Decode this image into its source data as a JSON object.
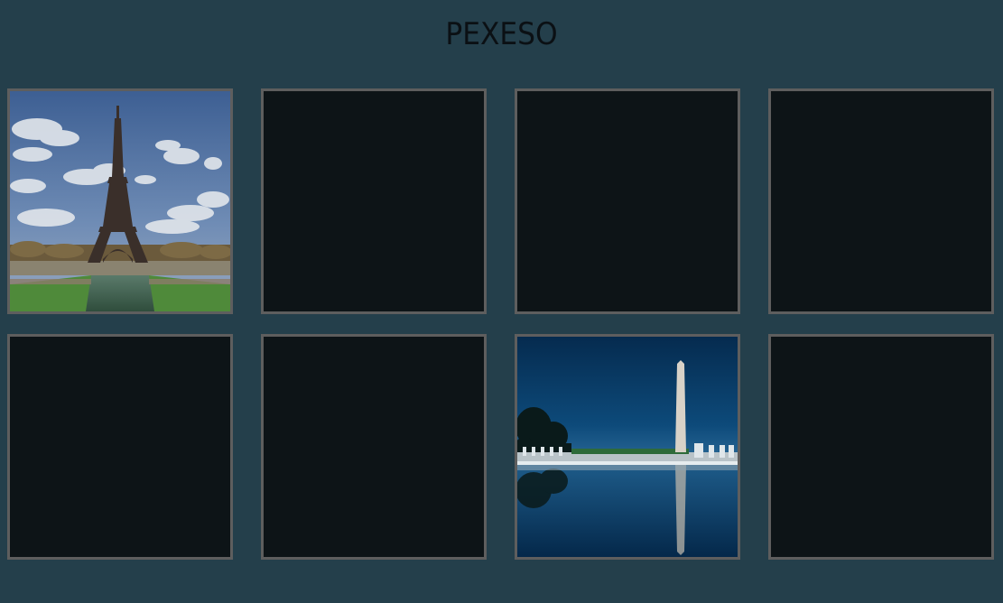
{
  "header": {
    "title": "PEXESO"
  },
  "board": {
    "cards": [
      {
        "state": "revealed",
        "image": "eiffel-tower"
      },
      {
        "state": "hidden",
        "image": ""
      },
      {
        "state": "hidden",
        "image": ""
      },
      {
        "state": "hidden",
        "image": ""
      },
      {
        "state": "hidden",
        "image": ""
      },
      {
        "state": "hidden",
        "image": ""
      },
      {
        "state": "revealed",
        "image": "washington-monument"
      },
      {
        "state": "hidden",
        "image": ""
      }
    ]
  },
  "colors": {
    "background": "#243f4b",
    "card_back": "#0d1417",
    "card_border": "#5e5e5e",
    "title": "#0b1014"
  }
}
